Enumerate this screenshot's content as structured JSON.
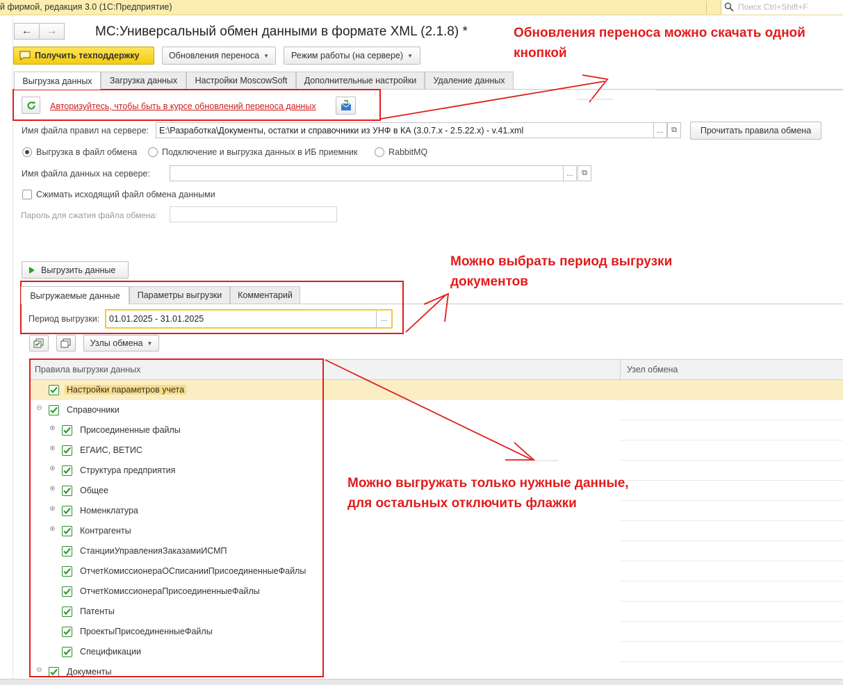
{
  "app": {
    "title": "й фирмой, редакция 3.0  (1С:Предприятие)",
    "search_placeholder": "Поиск Ctrl+Shift+F"
  },
  "form": {
    "title": "МС:Универсальный обмен данными в формате XML (2.1.8) *",
    "support_button": "Получить техподдержку",
    "updates_menu": "Обновления переноса",
    "mode_menu": "Режим работы (на сервере)"
  },
  "tabs": [
    {
      "label": "Выгрузка данных",
      "active": true
    },
    {
      "label": "Загрузка данных",
      "active": false
    },
    {
      "label": "Настройки MoscowSoft",
      "active": false
    },
    {
      "label": "Дополнительные настройки",
      "active": false
    },
    {
      "label": "Удаление данных",
      "active": false
    }
  ],
  "auth": {
    "link": "Авторизуйтесь, чтобы быть в курсе обновлений переноса данных"
  },
  "rules_file": {
    "label": "Имя файла правил на сервере:",
    "value": "E:\\Разработка\\Документы, остатки и справочники из УНФ в КА (3.0.7.x - 2.5.22.x) - v.41.xml",
    "read_button": "Прочитать правила обмена"
  },
  "export_mode": {
    "options": [
      {
        "label": "Выгрузка в файл обмена",
        "selected": true
      },
      {
        "label": "Подключение и выгрузка данных в ИБ приемник",
        "selected": false
      },
      {
        "label": "RabbitMQ",
        "selected": false
      }
    ]
  },
  "data_file": {
    "label": "Имя файла данных на сервере:",
    "value": ""
  },
  "compress": {
    "label": "Сжимать исходящий файл обмена данными",
    "checked": false
  },
  "password": {
    "label": "Пароль для сжатия файла обмена:",
    "value": ""
  },
  "export_button": "Выгрузить данные",
  "inner_tabs": [
    {
      "label": "Выгружаемые данные",
      "active": true
    },
    {
      "label": "Параметры выгрузки",
      "active": false
    },
    {
      "label": "Комментарий",
      "active": false
    }
  ],
  "period": {
    "label": "Период выгрузки:",
    "value": "01.01.2025 - 31.01.2025"
  },
  "nodes_menu": "Узлы обмена",
  "grid": {
    "columns": [
      "Правила выгрузки данных",
      "Узел обмена"
    ],
    "rows": [
      {
        "label": "Настройки параметров учета",
        "level": 0,
        "expander": "",
        "checked": true,
        "selected": true
      },
      {
        "label": "Справочники",
        "level": 0,
        "expander": "⊖",
        "checked": true,
        "selected": false
      },
      {
        "label": "Присоединенные файлы",
        "level": 1,
        "expander": "⊕",
        "checked": true,
        "selected": false
      },
      {
        "label": "ЕГАИС, ВЕТИС",
        "level": 1,
        "expander": "⊕",
        "checked": true,
        "selected": false
      },
      {
        "label": "Структура предприятия",
        "level": 1,
        "expander": "⊕",
        "checked": true,
        "selected": false
      },
      {
        "label": "Общее",
        "level": 1,
        "expander": "⊕",
        "checked": true,
        "selected": false
      },
      {
        "label": "Номенклатура",
        "level": 1,
        "expander": "⊕",
        "checked": true,
        "selected": false
      },
      {
        "label": "Контрагенты",
        "level": 1,
        "expander": "⊕",
        "checked": true,
        "selected": false
      },
      {
        "label": "СтанцииУправленияЗаказамиИСМП",
        "level": 1,
        "expander": "",
        "checked": true,
        "selected": false
      },
      {
        "label": "ОтчетКомиссионераОСписанииПрисоединенныеФайлы",
        "level": 1,
        "expander": "",
        "checked": true,
        "selected": false
      },
      {
        "label": "ОтчетКомиссионераПрисоединенныеФайлы",
        "level": 1,
        "expander": "",
        "checked": true,
        "selected": false
      },
      {
        "label": "Патенты",
        "level": 1,
        "expander": "",
        "checked": true,
        "selected": false
      },
      {
        "label": "ПроектыПрисоединенныеФайлы",
        "level": 1,
        "expander": "",
        "checked": true,
        "selected": false
      },
      {
        "label": "Спецификации",
        "level": 1,
        "expander": "",
        "checked": true,
        "selected": false
      },
      {
        "label": "Документы",
        "level": 0,
        "expander": "⊖",
        "checked": true,
        "selected": false
      }
    ]
  },
  "annotations": {
    "updates": [
      "Обновления переноса можно скачать одной",
      "кнопкой"
    ],
    "period": [
      "Можно выбрать период выгрузки",
      "документов"
    ],
    "data": [
      "Можно выгружать только нужные данные,",
      "для остальных отключить флажки"
    ]
  },
  "colors": {
    "annotation": "#e31b1b",
    "support_button": "#f5d01a",
    "selected_row": "#fbeec4",
    "checkbox": "#2e9b2e"
  }
}
